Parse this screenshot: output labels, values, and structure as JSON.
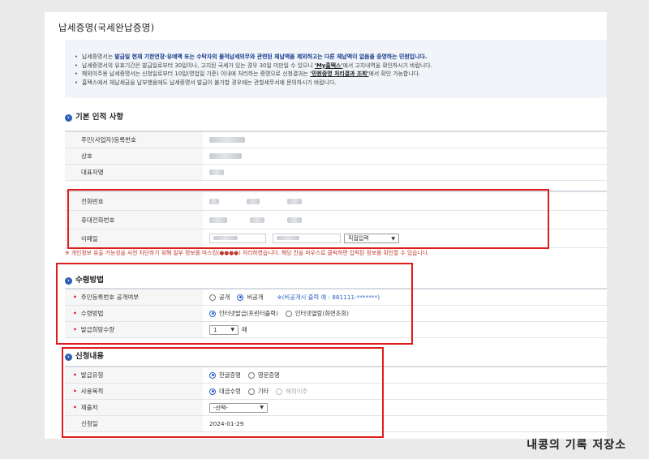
{
  "page_title": "납세증명(국세완납증명)",
  "notices": [
    {
      "pre": "납세증명서는 ",
      "bold": "발급일 현재 기한연장·유예액 또는 수탁자의 물적납세의무와 관련된 체납액을 제외하고는 다른 체납액이 없음을 증명하는 민원입니다.",
      "post": ""
    },
    {
      "pre": "납세증명서의 유효기간은 발급일로부터 30일이나, 고지된 국세가 있는 경우 30일 미만일 수 있으니 ",
      "bold": "'My홈택스'",
      "post": "에서 고지내역을 확인하시기 바랍니다."
    },
    {
      "pre": "해외이주용 납세증명서는 신청일로부터 10일(영업일 기준) 이내에 처리하는 증명으로 신청결과는 ",
      "bold": "'민원증명 처리결과 조회'",
      "post": "에서 확인 가능합니다."
    },
    {
      "pre": "홈택스에서 체납세금을 납부했음에도 납세증명서 발급이 불가할 경우에는 관할세무서에 문의하시기 바랍니다.",
      "bold": "",
      "post": ""
    }
  ],
  "basic": {
    "title": "기본 인적 사항",
    "resident_no_label": "주민(사업자)등록번호",
    "trade_name_label": "상호",
    "representative_label": "대표자명",
    "phone_label": "전화번호",
    "mobile_label": "휴대전화번호",
    "email_label": "이메일",
    "email_domain_select": "직접입력"
  },
  "mask_note": "※ 개인정보 유출 가능성을 사전 차단하기 위해 일부 정보를 마스킹(●●●●) 처리하였습니다. 해당 칸을 마우스로 클릭하면 입력된 정보를 확인할 수 있습니다.",
  "receive": {
    "title": "수령방법",
    "disclose_label": "주민등록번호 공개여부",
    "disclose_options": [
      "공개",
      "비공개"
    ],
    "disclose_note": "※(비공개시 출력 예 : 881111-*******)",
    "method_label": "수령방법",
    "method_options": [
      "인터넷발급(프린터출력)",
      "인터넷열람(화면조회)"
    ],
    "qty_label": "발급희망수량",
    "qty_value": "1",
    "qty_unit": "매"
  },
  "apply": {
    "title": "신청내용",
    "type_label": "발급유형",
    "type_options": [
      "한글증명",
      "영문증명"
    ],
    "purpose_label": "사용목적",
    "purpose_options": [
      "대금수령",
      "기타",
      "해외이주"
    ],
    "submit_label": "제출처",
    "submit_value": "-선택-",
    "date_label": "신청일",
    "date_value": "2024-01-29"
  },
  "brand": "내콩의 기록 저장소",
  "colors": {
    "accent": "#2b64c8",
    "highlight_box": "#e01d1d",
    "required": "#d9262b"
  }
}
